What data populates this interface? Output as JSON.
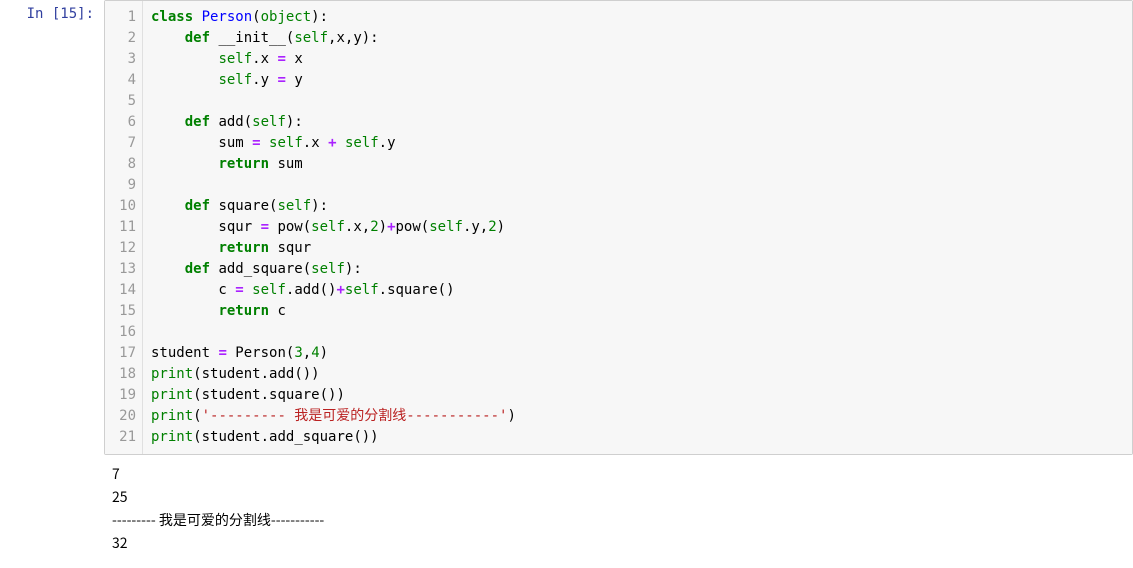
{
  "prompt_label": "In [15]:",
  "line_numbers": [
    "1",
    "2",
    "3",
    "4",
    "5",
    "6",
    "7",
    "8",
    "9",
    "10",
    "11",
    "12",
    "13",
    "14",
    "15",
    "16",
    "17",
    "18",
    "19",
    "20",
    "21"
  ],
  "code_lines": [
    [
      {
        "t": "class ",
        "c": "kw"
      },
      {
        "t": "Person",
        "c": "cls"
      },
      {
        "t": "(",
        "c": "pun"
      },
      {
        "t": "object",
        "c": "blt"
      },
      {
        "t": "):",
        "c": "pun"
      }
    ],
    [
      {
        "t": "    ",
        "c": "id"
      },
      {
        "t": "def ",
        "c": "kw"
      },
      {
        "t": "__init__",
        "c": "id"
      },
      {
        "t": "(",
        "c": "pun"
      },
      {
        "t": "self",
        "c": "slf"
      },
      {
        "t": ",x,y):",
        "c": "pun"
      }
    ],
    [
      {
        "t": "        ",
        "c": "id"
      },
      {
        "t": "self",
        "c": "slf"
      },
      {
        "t": ".",
        "c": "pun"
      },
      {
        "t": "x",
        "c": "id"
      },
      {
        "t": " ",
        "c": "id"
      },
      {
        "t": "=",
        "c": "op"
      },
      {
        "t": " x",
        "c": "id"
      }
    ],
    [
      {
        "t": "        ",
        "c": "id"
      },
      {
        "t": "self",
        "c": "slf"
      },
      {
        "t": ".",
        "c": "pun"
      },
      {
        "t": "y",
        "c": "id"
      },
      {
        "t": " ",
        "c": "id"
      },
      {
        "t": "=",
        "c": "op"
      },
      {
        "t": " y",
        "c": "id"
      }
    ],
    [
      {
        "t": " ",
        "c": "id"
      }
    ],
    [
      {
        "t": "    ",
        "c": "id"
      },
      {
        "t": "def ",
        "c": "kw"
      },
      {
        "t": "add",
        "c": "id"
      },
      {
        "t": "(",
        "c": "pun"
      },
      {
        "t": "self",
        "c": "slf"
      },
      {
        "t": "):",
        "c": "pun"
      }
    ],
    [
      {
        "t": "        sum ",
        "c": "id"
      },
      {
        "t": "=",
        "c": "op"
      },
      {
        "t": " ",
        "c": "id"
      },
      {
        "t": "self",
        "c": "slf"
      },
      {
        "t": ".",
        "c": "pun"
      },
      {
        "t": "x",
        "c": "id"
      },
      {
        "t": " ",
        "c": "id"
      },
      {
        "t": "+",
        "c": "op"
      },
      {
        "t": " ",
        "c": "id"
      },
      {
        "t": "self",
        "c": "slf"
      },
      {
        "t": ".",
        "c": "pun"
      },
      {
        "t": "y",
        "c": "id"
      }
    ],
    [
      {
        "t": "        ",
        "c": "id"
      },
      {
        "t": "return",
        "c": "kw"
      },
      {
        "t": " sum",
        "c": "id"
      }
    ],
    [
      {
        "t": " ",
        "c": "id"
      }
    ],
    [
      {
        "t": "    ",
        "c": "id"
      },
      {
        "t": "def ",
        "c": "kw"
      },
      {
        "t": "square",
        "c": "id"
      },
      {
        "t": "(",
        "c": "pun"
      },
      {
        "t": "self",
        "c": "slf"
      },
      {
        "t": "):",
        "c": "pun"
      }
    ],
    [
      {
        "t": "        squr ",
        "c": "id"
      },
      {
        "t": "=",
        "c": "op"
      },
      {
        "t": " pow(",
        "c": "id"
      },
      {
        "t": "self",
        "c": "slf"
      },
      {
        "t": ".",
        "c": "pun"
      },
      {
        "t": "x,",
        "c": "id"
      },
      {
        "t": "2",
        "c": "num"
      },
      {
        "t": ")",
        "c": "id"
      },
      {
        "t": "+",
        "c": "op"
      },
      {
        "t": "pow(",
        "c": "id"
      },
      {
        "t": "self",
        "c": "slf"
      },
      {
        "t": ".",
        "c": "pun"
      },
      {
        "t": "y,",
        "c": "id"
      },
      {
        "t": "2",
        "c": "num"
      },
      {
        "t": ")",
        "c": "id"
      }
    ],
    [
      {
        "t": "        ",
        "c": "id"
      },
      {
        "t": "return",
        "c": "kw"
      },
      {
        "t": " squr",
        "c": "id"
      }
    ],
    [
      {
        "t": "    ",
        "c": "id"
      },
      {
        "t": "def ",
        "c": "kw"
      },
      {
        "t": "add_square",
        "c": "id"
      },
      {
        "t": "(",
        "c": "pun"
      },
      {
        "t": "self",
        "c": "slf"
      },
      {
        "t": "):",
        "c": "pun"
      }
    ],
    [
      {
        "t": "        c ",
        "c": "id"
      },
      {
        "t": "=",
        "c": "op"
      },
      {
        "t": " ",
        "c": "id"
      },
      {
        "t": "self",
        "c": "slf"
      },
      {
        "t": ".",
        "c": "pun"
      },
      {
        "t": "add()",
        "c": "id"
      },
      {
        "t": "+",
        "c": "op"
      },
      {
        "t": "self",
        "c": "slf"
      },
      {
        "t": ".",
        "c": "pun"
      },
      {
        "t": "square()",
        "c": "id"
      }
    ],
    [
      {
        "t": "        ",
        "c": "id"
      },
      {
        "t": "return",
        "c": "kw"
      },
      {
        "t": " c",
        "c": "id"
      }
    ],
    [
      {
        "t": " ",
        "c": "id"
      }
    ],
    [
      {
        "t": "student ",
        "c": "id"
      },
      {
        "t": "=",
        "c": "op"
      },
      {
        "t": " Person(",
        "c": "id"
      },
      {
        "t": "3",
        "c": "num"
      },
      {
        "t": ",",
        "c": "id"
      },
      {
        "t": "4",
        "c": "num"
      },
      {
        "t": ")",
        "c": "id"
      }
    ],
    [
      {
        "t": "print",
        "c": "blt"
      },
      {
        "t": "(student",
        "c": "id"
      },
      {
        "t": ".",
        "c": "pun"
      },
      {
        "t": "add())",
        "c": "id"
      }
    ],
    [
      {
        "t": "print",
        "c": "blt"
      },
      {
        "t": "(student",
        "c": "id"
      },
      {
        "t": ".",
        "c": "pun"
      },
      {
        "t": "square())",
        "c": "id"
      }
    ],
    [
      {
        "t": "print",
        "c": "blt"
      },
      {
        "t": "(",
        "c": "id"
      },
      {
        "t": "'--------- 我是可爱的分割线-----------'",
        "c": "str"
      },
      {
        "t": ")",
        "c": "id"
      }
    ],
    [
      {
        "t": "print",
        "c": "blt"
      },
      {
        "t": "(student",
        "c": "id"
      },
      {
        "t": ".",
        "c": "pun"
      },
      {
        "t": "add_square())",
        "c": "id"
      }
    ]
  ],
  "output_lines": [
    "7",
    "25",
    "--------- 我是可爱的分割线-----------",
    "32"
  ]
}
